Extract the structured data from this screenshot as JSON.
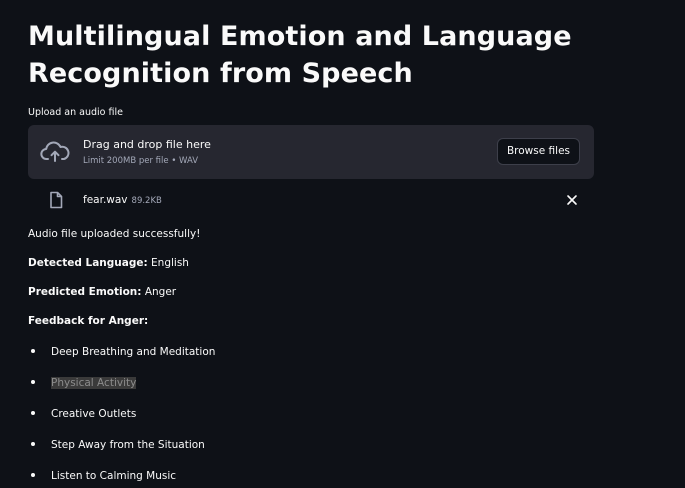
{
  "header": {
    "title_line1": "Multilingual Emotion and Language",
    "title_line2": "Recognition from Speech"
  },
  "uploader": {
    "label": "Upload an audio file",
    "drop_title": "Drag and drop file here",
    "drop_limits": "Limit 200MB per file • WAV",
    "browse_label": "Browse files",
    "icons": {
      "upload": "cloud-upload-icon",
      "file": "file-icon",
      "remove": "close-icon"
    }
  },
  "uploaded_file": {
    "name": "fear.wav",
    "size": "89.2KB"
  },
  "results": {
    "success_message": "Audio file uploaded successfully!",
    "language_label": "Detected Language:",
    "language_value": "English",
    "emotion_label": "Predicted Emotion:",
    "emotion_value": "Anger",
    "feedback_heading": "Feedback for Anger:"
  },
  "feedback_items": [
    "Deep Breathing and Meditation",
    "Physical Activity",
    "Creative Outlets",
    "Step Away from the Situation",
    "Listen to Calming Music"
  ],
  "colors": {
    "background": "#0e1117",
    "panel": "#262730",
    "text": "#fafafa",
    "muted": "#a3a8b8"
  }
}
